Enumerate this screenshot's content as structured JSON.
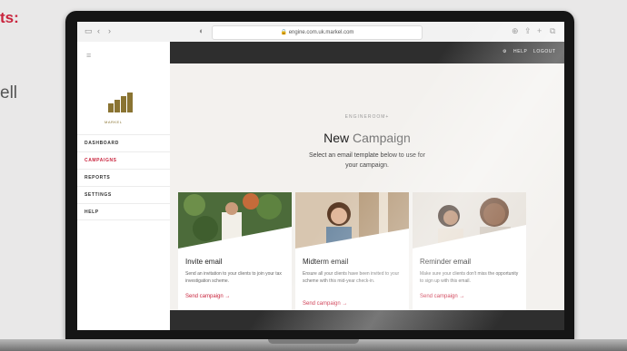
{
  "slide": {
    "heading_fragment": "ts:",
    "body_fragment": "ell"
  },
  "browser": {
    "url": "engine.com.uk.markel.com"
  },
  "sidebar": {
    "logo_text": "MARKEL",
    "items": [
      {
        "label": "DASHBOARD",
        "active": false
      },
      {
        "label": "CAMPAIGNS",
        "active": true
      },
      {
        "label": "REPORTS",
        "active": false
      },
      {
        "label": "SETTINGS",
        "active": false
      },
      {
        "label": "HELP",
        "active": false
      }
    ]
  },
  "topbar": {
    "help": "HELP",
    "logout": "LOGOUT"
  },
  "main": {
    "kicker": "ENGINEROOM+",
    "title_strong": "New",
    "title_light": "Campaign",
    "subtitle_line1": "Select an email template below to use for",
    "subtitle_line2": "your campaign."
  },
  "cards": [
    {
      "title": "Invite email",
      "description": "Send an invitation to your clients to join your tax investigation scheme.",
      "link": "Send campaign →"
    },
    {
      "title": "Midterm email",
      "description": "Ensure all your clients have been invited to your scheme with this mid-year check-in.",
      "link": "Send campaign →"
    },
    {
      "title": "Reminder email",
      "description": "Make sure your clients don't miss the opportunity to sign up with this email.",
      "link": "Send campaign →"
    }
  ],
  "colors": {
    "accent": "#c9243d",
    "dark_bar": "#2e2e2e",
    "content_bg": "#f3f1ee",
    "logo_gold": "#8a7432"
  }
}
